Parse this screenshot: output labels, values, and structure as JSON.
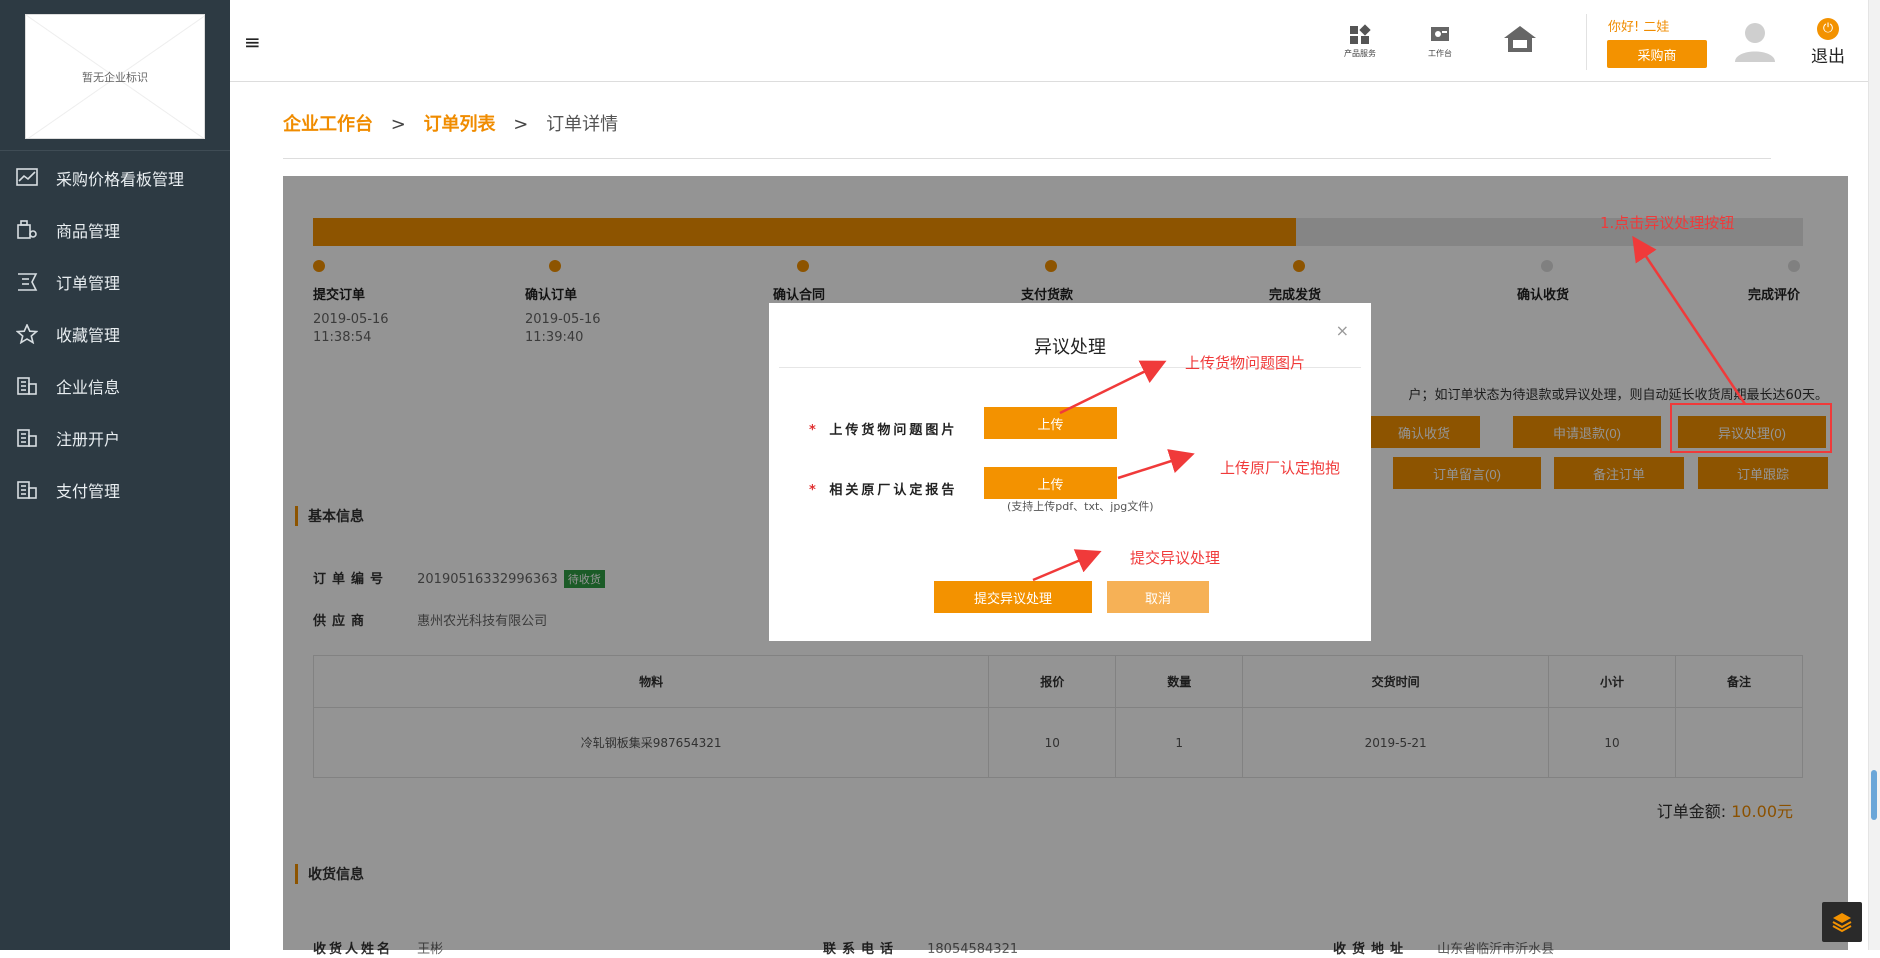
{
  "sidebar": {
    "logo_text": "暂无企业标识",
    "items": [
      {
        "label": "采购价格看板管理",
        "icon": "chart-line-icon"
      },
      {
        "label": "商品管理",
        "icon": "goods-icon"
      },
      {
        "label": "订单管理",
        "icon": "order-icon"
      },
      {
        "label": "收藏管理",
        "icon": "star-icon"
      },
      {
        "label": "企业信息",
        "icon": "building-icon"
      },
      {
        "label": "注册开户",
        "icon": "building-icon"
      },
      {
        "label": "支付管理",
        "icon": "building-icon"
      }
    ]
  },
  "topbar": {
    "menu_glyph": "≡",
    "icons": [
      {
        "label": "产品服务",
        "icon": "grid-icon"
      },
      {
        "label": "工作台",
        "icon": "workbench-icon"
      },
      {
        "label": "",
        "icon": "home-icon"
      }
    ],
    "greeting": "你好! 二娃",
    "role_button": "采购商",
    "logout": "退出"
  },
  "breadcrumb": {
    "items": [
      "企业工作台",
      "订单列表",
      "订单详情"
    ],
    "sep": ">"
  },
  "progress": {
    "percent": 66,
    "steps": [
      {
        "label": "提交订单",
        "date": "2019-05-16",
        "time": "11:38:54",
        "done": true
      },
      {
        "label": "确认订单",
        "date": "2019-05-16",
        "time": "11:39:40",
        "done": true
      },
      {
        "label": "确认合同",
        "date": "",
        "time": "",
        "done": true
      },
      {
        "label": "支付货款",
        "date": "",
        "time": "",
        "done": true
      },
      {
        "label": "完成发货",
        "date": "",
        "time": "",
        "done": true
      },
      {
        "label": "确认收货",
        "date": "",
        "time": "",
        "done": false
      },
      {
        "label": "完成评价",
        "date": "",
        "time": "",
        "done": false
      }
    ]
  },
  "notice": "户；如订单状态为待退款或异议处理，则自动延长收货周期最长达60天。",
  "actions": {
    "confirm": "确认收货",
    "refund": "申请退款(0)",
    "dispute": "异议处理(0)",
    "message": "订单留言(0)",
    "remark": "备注订单",
    "track": "订单跟踪"
  },
  "basic": {
    "title": "基本信息",
    "order_no_label": "订单编号",
    "order_no": "20190516332996363",
    "status": "待收货",
    "supplier_label": "供应商",
    "supplier": "惠州农光科技有限公司",
    "columns": [
      "物料",
      "报价",
      "数量",
      "交货时间",
      "小计",
      "备注"
    ],
    "rows": [
      [
        "冷轧钢板集采987654321",
        "10",
        "1",
        "2019-5-21",
        "10",
        ""
      ]
    ],
    "total_label": "订单金额:",
    "total": "10.00元"
  },
  "receive": {
    "title": "收货信息",
    "name_label": "收货人姓名",
    "name": "王彬",
    "phone_label": "联系电话",
    "phone": "18054584321",
    "addr_label": "收货地址",
    "addr": "山东省临沂市沂水县"
  },
  "modal": {
    "title": "异议处理",
    "close": "×",
    "field1_label": "上传货物问题图片",
    "field2_label": "相关原厂认定报告",
    "upload": "上传",
    "required": "*",
    "hint": "(支持上传pdf、txt、jpg文件)",
    "submit": "提交异议处理",
    "cancel": "取消"
  },
  "annotations": {
    "a1": "上传货物问题图片",
    "a2": "上传原厂认定抱抱",
    "a3": "提交异议处理",
    "a4": "1.点击异议处理按钮"
  },
  "colors": {
    "accent": "#f39200",
    "sidebar": "#2d3a43",
    "annotation": "#f03a3a",
    "status_green": "#2f9e44"
  }
}
